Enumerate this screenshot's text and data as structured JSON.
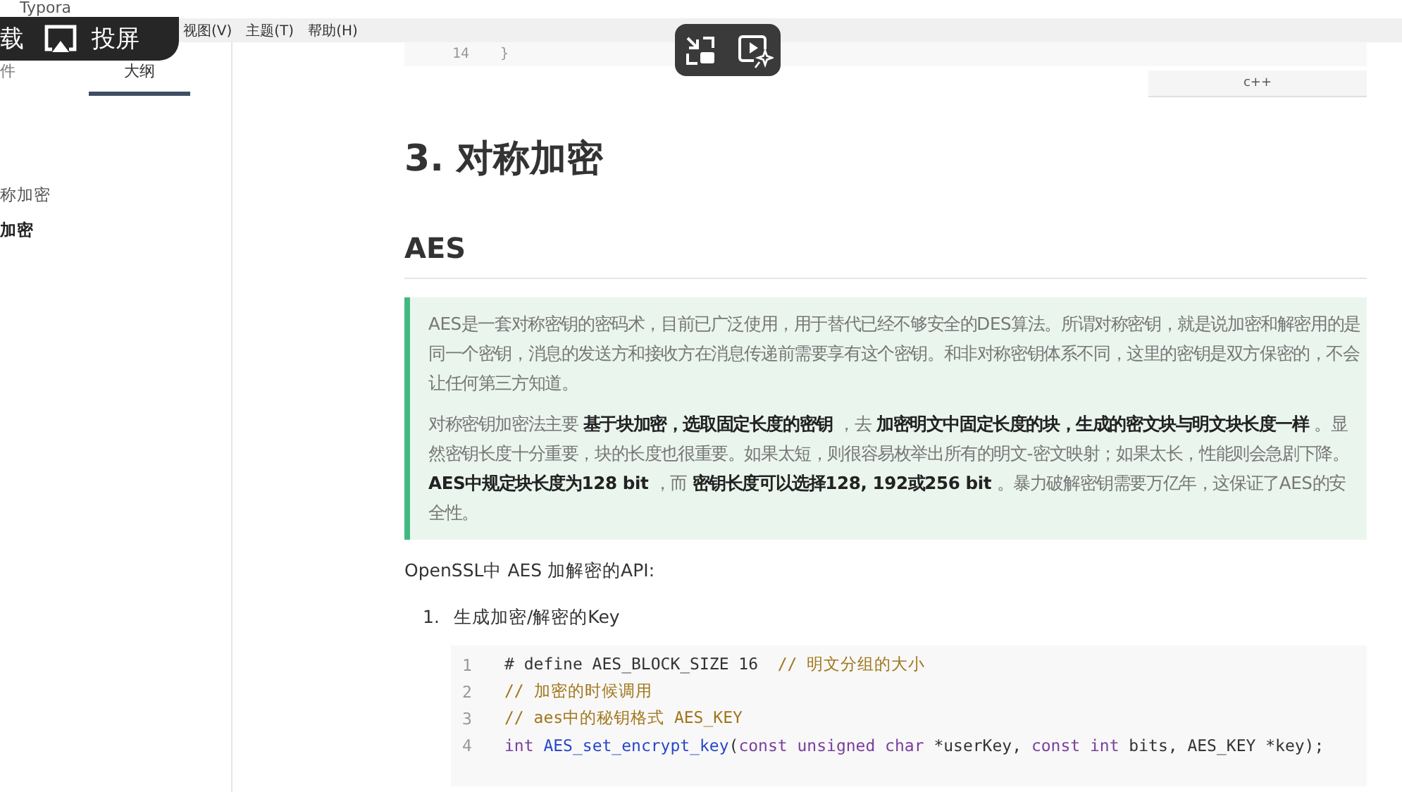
{
  "window": {
    "title": "Typora"
  },
  "menu_bar": [
    "视图(V)",
    "主题(T)",
    "帮助(H)"
  ],
  "sidebar": {
    "tabs": [
      {
        "label": "件",
        "selected": false
      },
      {
        "label": "大纲",
        "selected": true
      }
    ],
    "outline": [
      {
        "label": "称加密",
        "selected": false
      },
      {
        "label": "加密",
        "selected": true
      }
    ]
  },
  "document": {
    "prev_code": {
      "line_number": "14",
      "text": "}",
      "language": "c++"
    },
    "h2": "3. 对称加密",
    "h3": "AES",
    "blockquote": [
      "AES是一套对称密钥的密码术，目前已广泛使用，用于替代已经不够安全的DES算法。所谓对称密钥，就是说加密和解密用的是同一个密钥，消息的发送方和接收方在消息传递前需要享有这个密钥。和非对称密钥体系不同，这里的密钥是双方保密的，不会让任何第三方知道。",
      "对称密钥加密法主要 **基于块加密，选取固定长度的密钥** ，去 **加密明文中固定长度的块，生成的密文块与明文块长度一样** 。显然密钥长度十分重要，块的长度也很重要。如果太短，则很容易枚举出所有的明文-密文映射；如果太长，性能则会急剧下降。 **AES中规定块长度为128 bit** ，而 **密钥长度可以选择128, 192或256 bit** 。暴力破解密钥需要万亿年，这保证了AES的安全性。"
    ],
    "paragraph": "OpenSSL中 AES 加解密的API:",
    "list": [
      {
        "number": "1.",
        "text": "生成加密/解密的Key"
      }
    ],
    "code": [
      {
        "line_number": "1",
        "tokens": [
          {
            "kind": "plain",
            "text": "# define AES_BLOCK_SIZE 16  "
          },
          {
            "kind": "comment",
            "text": "// 明文分组的大小"
          }
        ]
      },
      {
        "line_number": "2",
        "tokens": [
          {
            "kind": "comment",
            "text": "// 加密的时候调用"
          }
        ]
      },
      {
        "line_number": "3",
        "tokens": [
          {
            "kind": "comment",
            "text": "// aes中的秘钥格式 AES_KEY"
          }
        ]
      },
      {
        "line_number": "4",
        "tokens": [
          {
            "kind": "keyword",
            "text": "int "
          },
          {
            "kind": "function",
            "text": "AES_set_encrypt_key"
          },
          {
            "kind": "plain",
            "text": "("
          },
          {
            "kind": "keyword",
            "text": "const unsigned char"
          },
          {
            "kind": "plain",
            "text": " *userKey, "
          },
          {
            "kind": "keyword",
            "text": "const int"
          },
          {
            "kind": "plain",
            "text": " bits, AES_KEY *key);"
          }
        ]
      }
    ]
  },
  "player_overlay": {
    "labels": [
      "载",
      "投屏"
    ]
  }
}
